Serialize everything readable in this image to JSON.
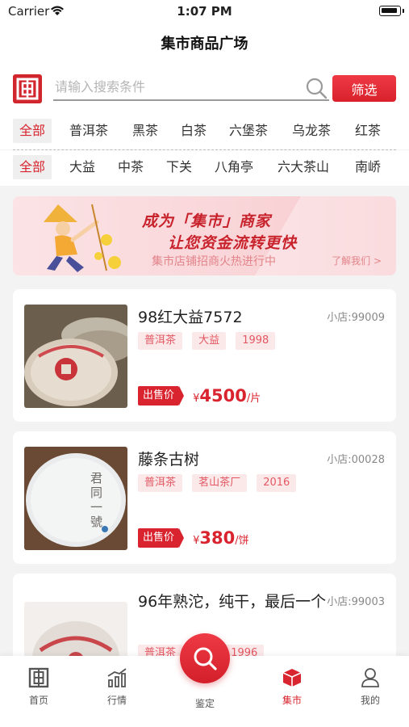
{
  "status": {
    "carrier": "Carrier",
    "time": "1:07 PM"
  },
  "nav": {
    "title": "集市商品广场"
  },
  "search": {
    "placeholder": "请输入搜索条件",
    "value": "",
    "filter_label": "筛选"
  },
  "category_tabs": [
    "全部",
    "普洱茶",
    "黑茶",
    "白茶",
    "六堡茶",
    "乌龙茶",
    "红茶"
  ],
  "brand_tabs": [
    "全部",
    "大益",
    "中茶",
    "下关",
    "八角亭",
    "六大茶山",
    "南峤"
  ],
  "banner": {
    "line1": "成为「集市」商家",
    "line2": "让您资金流转更快",
    "sub": "集市店铺招商火热进行中",
    "more": "了解我们 >"
  },
  "products": [
    {
      "name": "98红大益7572",
      "store": "小店:99009",
      "tags": [
        "普洱茶",
        "大益",
        "1998"
      ],
      "price_label": "出售价",
      "currency": "¥",
      "price": "4500",
      "unit": "/片",
      "thumb_icon": "tea-cake-red-wrapper-image"
    },
    {
      "name": "藤条古树",
      "store": "小店:00028",
      "tags": [
        "普洱茶",
        "茗山茶厂",
        "2016"
      ],
      "price_label": "出售价",
      "currency": "¥",
      "price": "380",
      "unit": "/饼",
      "thumb_icon": "tea-cake-white-wrapper-image"
    },
    {
      "name": "96年熟沱，纯干，最后一个",
      "store": "小店:99003",
      "tags": [
        "普洱茶",
        "",
        "1996"
      ],
      "price_label": "",
      "currency": "",
      "price": "",
      "unit": "",
      "thumb_icon": "tuocha-image"
    }
  ],
  "tabbar": {
    "items": [
      {
        "label": "首页",
        "icon": "home-logo-icon"
      },
      {
        "label": "行情",
        "icon": "chart-icon"
      },
      {
        "label": "鉴定",
        "icon": "search-icon"
      },
      {
        "label": "集市",
        "icon": "market-box-icon"
      },
      {
        "label": "我的",
        "icon": "person-icon"
      }
    ],
    "active": "集市"
  },
  "colors": {
    "accent": "#d8252f",
    "tag_bg": "#fbe9ea",
    "background": "#f3f3f3"
  }
}
